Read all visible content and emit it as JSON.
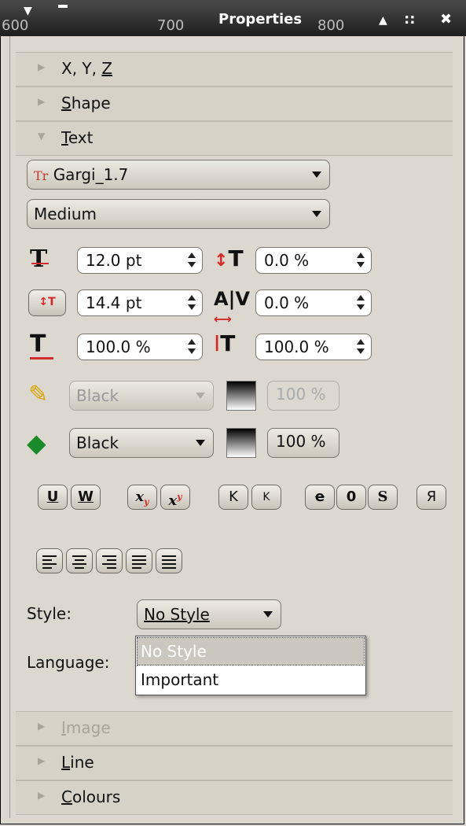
{
  "window": {
    "title": "Properties",
    "ruler_marks": [
      "600",
      "700",
      "800"
    ],
    "controls": [
      "▲",
      "::",
      "✖"
    ]
  },
  "sections_top": [
    {
      "label_pre": "X, Y, ",
      "label_u": "Z",
      "label_post": ""
    },
    {
      "label_pre": "",
      "label_u": "S",
      "label_post": "hape"
    },
    {
      "label_pre": "",
      "label_u": "T",
      "label_post": "ext"
    }
  ],
  "text": {
    "font": "Gargi_1.7",
    "font_icon": "Tr",
    "weight": "Medium",
    "font_size": "12.0 pt",
    "line_spacing": "14.4 pt",
    "scale_x": "100.0 %",
    "offset": "0.0 %",
    "kerning": "0.0 %",
    "scale_y": "100.0 %",
    "stroke_color": "Black",
    "stroke_shade": "100 %",
    "fill_color": "Black",
    "fill_shade": "100 %",
    "style_buttons": [
      "U",
      "W",
      "x",
      "x",
      "K",
      "K",
      "e",
      "0",
      "S",
      "Я"
    ],
    "style_label": "Style:",
    "style_value": "No Style",
    "language_label": "Language:",
    "dropdown_options": [
      "No Style",
      "Important"
    ]
  },
  "sections_bottom": [
    {
      "label_u": "I",
      "label_post": "mage",
      "disabled": true
    },
    {
      "label_u": "L",
      "label_post": "ine",
      "disabled": false
    },
    {
      "label_u": "C",
      "label_post": "olours",
      "disabled": false
    }
  ],
  "colors": {
    "accent_red": "#d22b2b",
    "background": "#dcd8cf",
    "titlebar": "#2a2a2a"
  }
}
